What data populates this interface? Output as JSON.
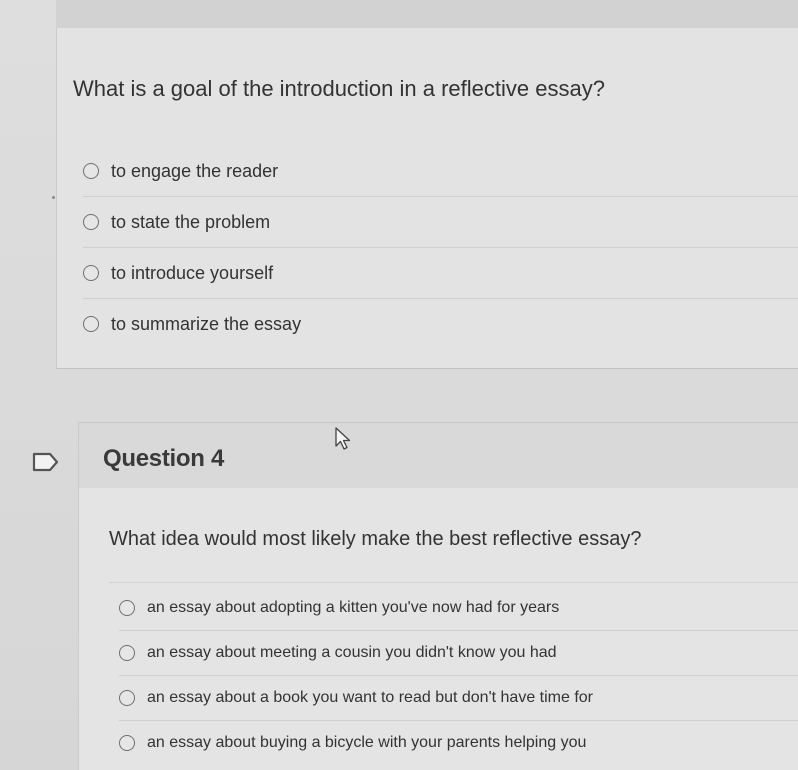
{
  "question_3": {
    "prompt": "What is a goal of the introduction in a reflective essay?",
    "options": [
      {
        "label": "to engage the reader"
      },
      {
        "label": "to state the problem"
      },
      {
        "label": "to introduce yourself"
      },
      {
        "label": "to summarize the essay"
      }
    ]
  },
  "question_4": {
    "title": "Question 4",
    "prompt": "What idea would most likely make the best reflective essay?",
    "options": [
      {
        "label": "an essay about adopting a kitten you've now had for years"
      },
      {
        "label": "an essay about meeting a cousin you didn't know you had"
      },
      {
        "label": "an essay about a book you want to read but don't have time for"
      },
      {
        "label": "an essay about buying a bicycle with your parents helping you"
      }
    ]
  },
  "icons": {
    "flag": "flag-icon",
    "cursor": "mouse-pointer-icon"
  },
  "colors": {
    "background": "#d8d8d8",
    "card": "#e4e4e4",
    "text": "#333333",
    "radio_border": "#6f6f6f"
  }
}
